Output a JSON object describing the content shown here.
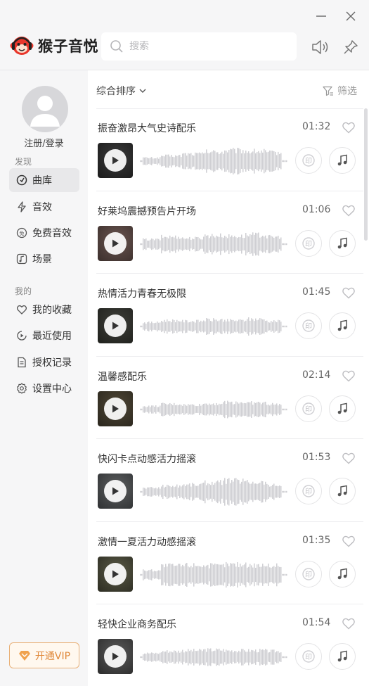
{
  "app": {
    "name": "猴子音悦",
    "search_placeholder": "搜索"
  },
  "sidebar": {
    "login_label": "注册/登录",
    "section_discover": "发现",
    "section_mine": "我的",
    "discover_items": [
      {
        "label": "曲库",
        "icon": "vinyl-icon",
        "active": true
      },
      {
        "label": "音效",
        "icon": "lightning-icon",
        "active": false
      },
      {
        "label": "免费音效",
        "icon": "free-badge-icon",
        "active": false
      },
      {
        "label": "场景",
        "icon": "music-note-square-icon",
        "active": false
      }
    ],
    "mine_items": [
      {
        "label": "我的收藏",
        "icon": "heart-icon"
      },
      {
        "label": "最近使用",
        "icon": "recent-play-icon"
      },
      {
        "label": "授权记录",
        "icon": "document-icon"
      },
      {
        "label": "设置中心",
        "icon": "gear-icon"
      }
    ],
    "vip_label": "开通VIP"
  },
  "toolbar": {
    "sort_label": "综合排序",
    "filter_label": "筛选"
  },
  "tracks": [
    {
      "title": "振奋激昂大气史诗配乐",
      "duration": "01:32"
    },
    {
      "title": "好莱坞震撼预告片开场",
      "duration": "01:06"
    },
    {
      "title": "热情活力青春无极限",
      "duration": "01:45"
    },
    {
      "title": "温馨感配乐",
      "duration": "02:14"
    },
    {
      "title": "快闪卡点动感活力摇滚",
      "duration": "01:53"
    },
    {
      "title": "激情一夏活力动感摇滚",
      "duration": "01:35"
    },
    {
      "title": "轻快企业商务配乐",
      "duration": "01:54"
    }
  ],
  "colors": {
    "brand_red": "#e8362b",
    "vip_orange": "#e0893b",
    "waveform": "#cfcfd3",
    "icon_gray": "#9a9a9e"
  }
}
